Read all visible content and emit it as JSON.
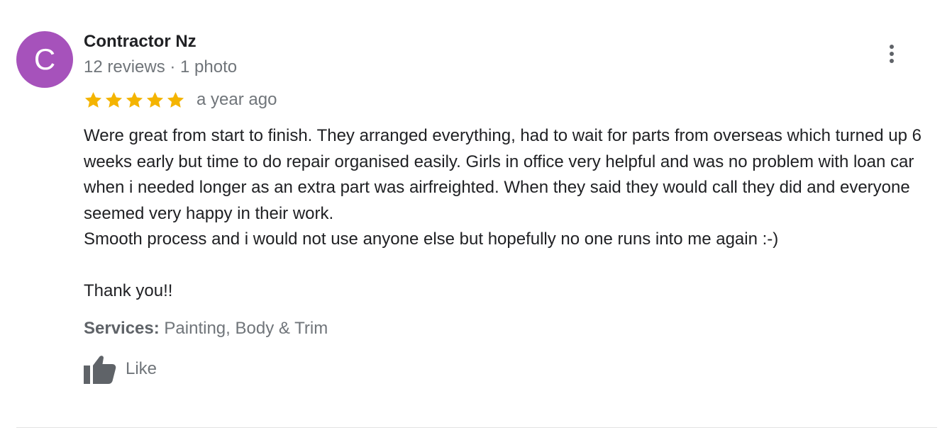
{
  "reviewer": {
    "avatar_letter": "C",
    "avatar_color": "#a652bb",
    "name": "Contractor Nz",
    "meta": "12 reviews · 1 photo"
  },
  "rating": {
    "stars": 5,
    "star_color": "#f4b400",
    "time": "a year ago"
  },
  "review": {
    "paragraph_1": "Were great from start to finish. They arranged everything, had to wait for parts from overseas which turned up 6 weeks early but time to do repair organised easily. Girls in office very helpful and was no problem with loan car when i needed longer as an extra part was airfreighted. When they said they would call they did and everyone seemed very happy in their work.",
    "paragraph_2": "Smooth process and i would not use anyone else but hopefully no one runs into me again :-)",
    "paragraph_3": "Thank you!!"
  },
  "services": {
    "label": "Services:",
    "value": "Painting, Body & Trim"
  },
  "actions": {
    "like_label": "Like",
    "like_icon": "thumbs-up-icon",
    "more_icon": "more-vert-icon"
  }
}
